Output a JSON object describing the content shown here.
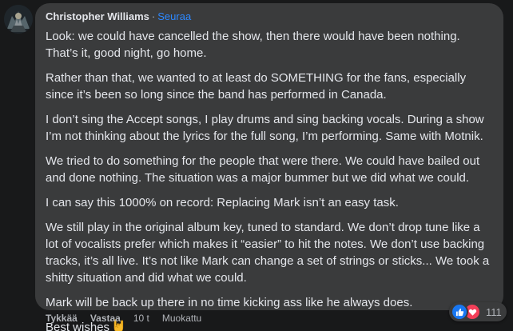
{
  "comment": {
    "author": "Christopher Williams",
    "separator": "·",
    "follow_label": "Seuraa",
    "paragraphs": [
      "Look: we could have cancelled the show, then there would have been nothing. That’s it, good night, go home.",
      "Rather than that, we wanted to at least do SOMETHING for the fans, especially since it’s been so long since the band has performed in Canada.",
      "I don’t sing the Accept songs, I play drums and sing backing vocals. During a show I’m not thinking about the lyrics for the full song, I’m performing. Same with Motnik.",
      "We tried to do something for the people that were there. We could have bailed out and done nothing. The situation was a major bummer but we did what we could.",
      "I can say this 1000% on record: Replacing Mark isn’t an easy task.",
      "We still play in the original album key, tuned to standard. We don’t drop tune like a lot of vocalists prefer which makes it “easier” to hit the notes. We don’t use backing tracks, it’s all live. It’s not like Mark can change a set of strings or sticks... We took a shitty situation and did what we could.",
      "Mark will be back up there in no time kicking ass like he always does."
    ],
    "closing": "Best wishes",
    "closing_emoji_icon": "rock-on-hand-icon",
    "reactions": {
      "icons": [
        "like-icon",
        "love-icon"
      ],
      "count": "111"
    }
  },
  "actions": {
    "like_label": "Tykkää",
    "reply_label": "Vastaa",
    "time_label": "10 t",
    "edited_label": "Muokattu"
  },
  "colors": {
    "background": "#18191a",
    "bubble": "#3a3b3c",
    "text": "#e4e6eb",
    "secondary_text": "#b0b3b8",
    "link": "#2d88ff",
    "like_blue": "#1877f2",
    "love_red": "#f33e58"
  }
}
